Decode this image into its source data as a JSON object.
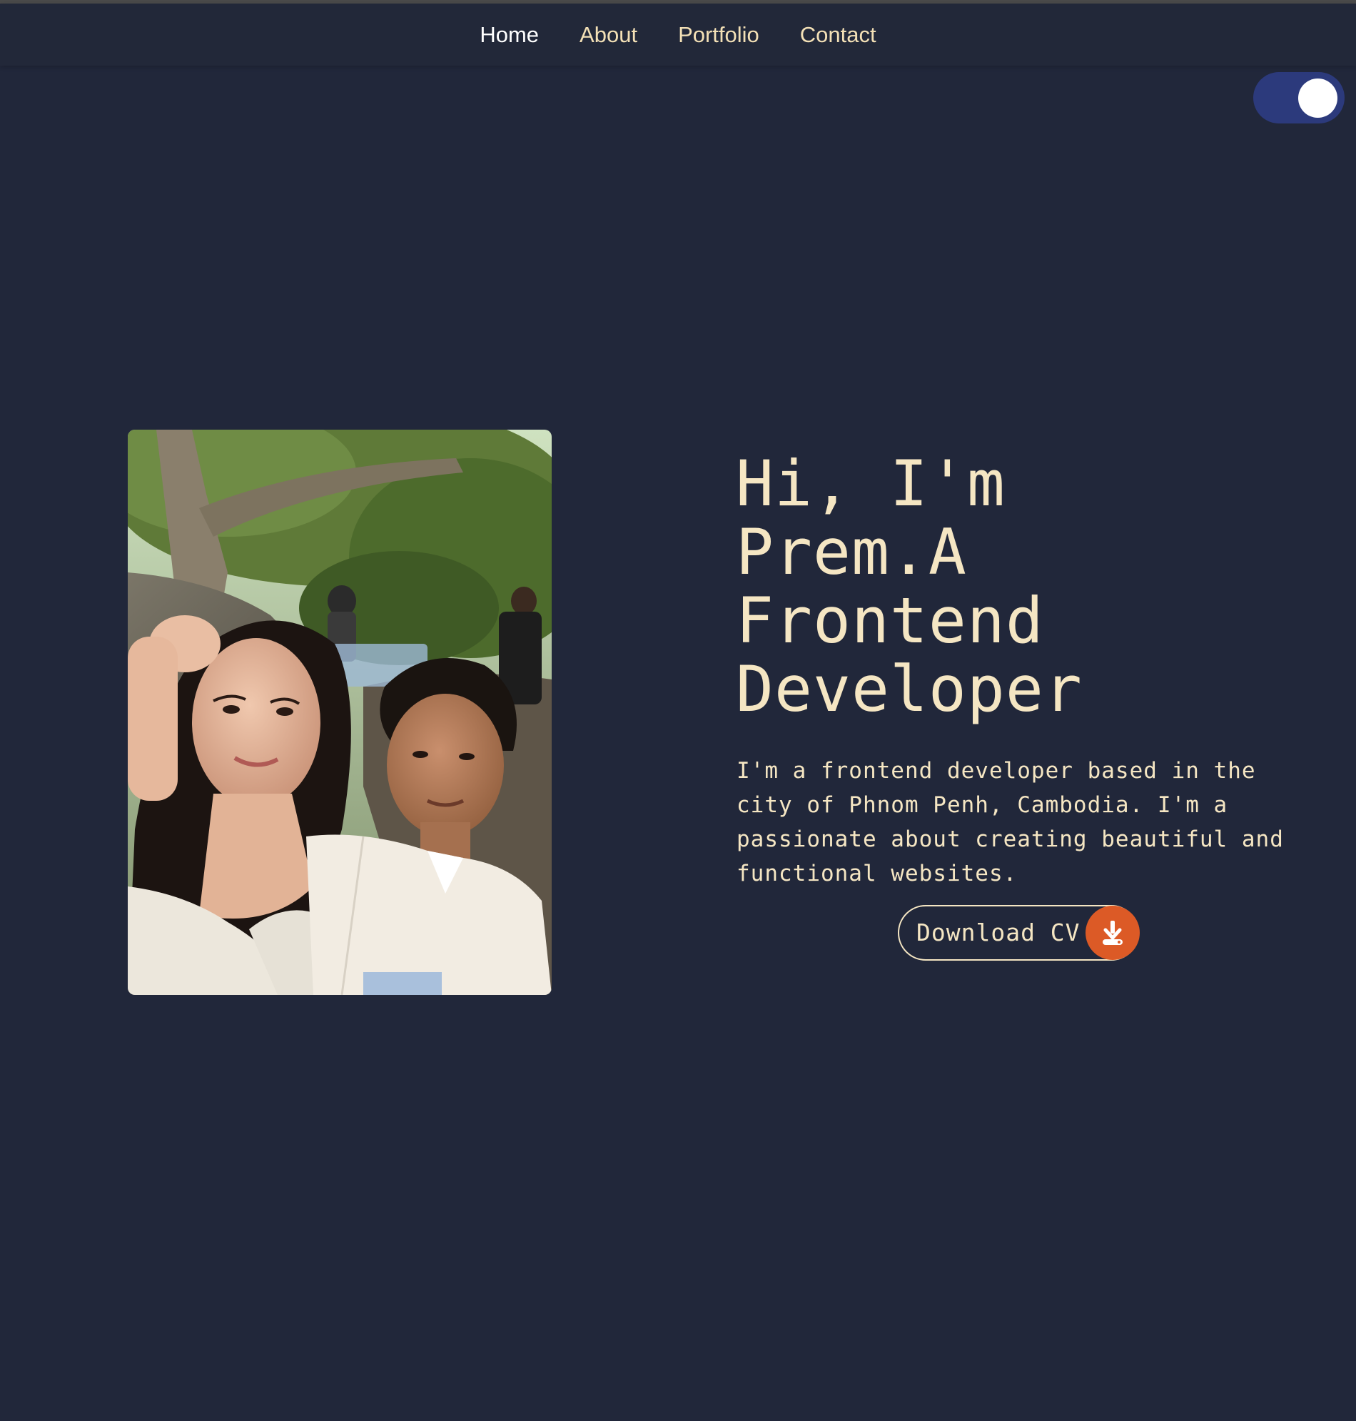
{
  "nav": {
    "items": [
      {
        "label": "Home",
        "active": true
      },
      {
        "label": "About"
      },
      {
        "label": "Portfolio"
      },
      {
        "label": "Contact"
      }
    ]
  },
  "theme_toggle": {
    "state": "on",
    "track_color": "#2c3a7c",
    "knob_color": "#ffffff"
  },
  "hero": {
    "photo_icon": "profile-photo",
    "title_lines": [
      "Hi, I'm",
      "Prem.A",
      "Frontend",
      "Developer"
    ],
    "description": "I'm a frontend developer based in the city of Phnom Penh, Cambodia. I'm a passionate about creating beautiful and functional websites.",
    "cta": {
      "label": "Download CV",
      "icon": "download-icon",
      "accent_color": "#dc5a26"
    }
  },
  "colors": {
    "background": "#21273a",
    "text_accent": "#f5e6c3"
  }
}
